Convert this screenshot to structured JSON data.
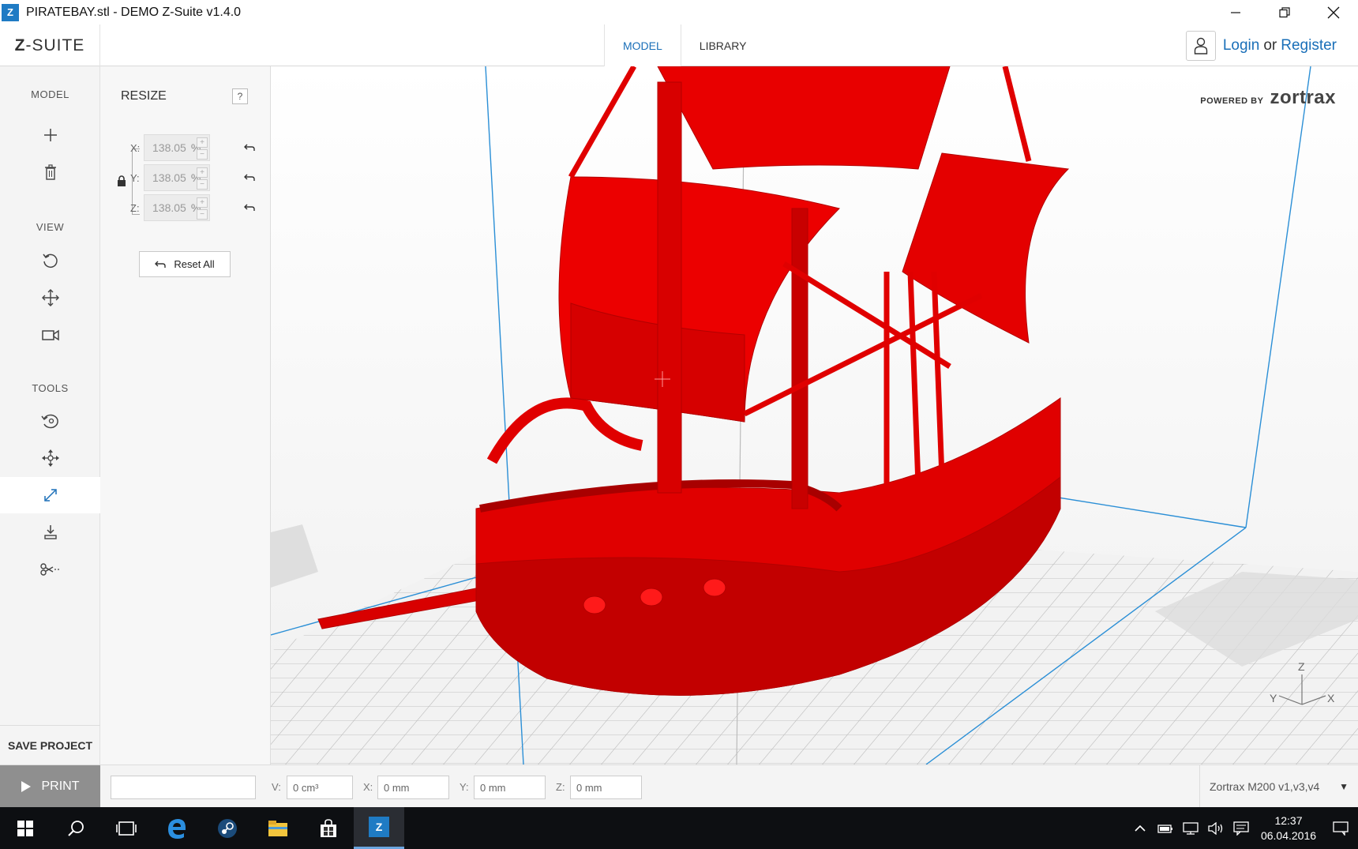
{
  "window": {
    "app_icon_letter": "Z",
    "title": "PIRATEBAY.stl - DEMO Z-Suite v1.4.0"
  },
  "header": {
    "logo_prefix": "Z",
    "logo_rest": "-SUITE",
    "tabs": [
      {
        "label": "MODEL",
        "active": true
      },
      {
        "label": "LIBRARY",
        "active": false
      }
    ],
    "login_label": "Login",
    "or_label": "or",
    "register_label": "Register"
  },
  "sidebar": {
    "model_label": "MODEL",
    "view_label": "VIEW",
    "tools_label": "TOOLS",
    "save_project_label": "SAVE PROJECT",
    "icons": [
      "add-icon",
      "trash-icon",
      "rotate-view-icon",
      "pan-icon",
      "camera-icon",
      "rotate-tool-icon",
      "move-tool-icon",
      "resize-tool-icon",
      "place-on-bed-icon",
      "cut-icon"
    ],
    "active_tool": "resize-tool-icon"
  },
  "resize_panel": {
    "title": "RESIZE",
    "help_label": "?",
    "axes": [
      {
        "label": "X:",
        "value": "138.05",
        "unit": "%"
      },
      {
        "label": "Y:",
        "value": "138.05",
        "unit": "%"
      },
      {
        "label": "Z:",
        "value": "138.05",
        "unit": "%"
      }
    ],
    "stepper_plus": "+",
    "stepper_minus": "−",
    "reset_all_label": "Reset All"
  },
  "viewport": {
    "powered_by": "POWERED BY",
    "brand": "zortrax",
    "model_color": "#ee0000",
    "axis_labels": {
      "z": "Z",
      "y": "Y",
      "x": "X"
    }
  },
  "statusbar": {
    "print_label": "PRINT",
    "progress_text": "",
    "volume_label": "V:",
    "volume_value": "0 cm³",
    "x_label": "X:",
    "x_value": "0 mm",
    "y_label": "Y:",
    "y_value": "0 mm",
    "z_label": "Z:",
    "z_value": "0 mm",
    "printer": "Zortrax M200 v1,v3,v4",
    "printer_caret": "▼"
  },
  "taskbar": {
    "items": [
      "windows-start-icon",
      "search-icon",
      "task-view-icon",
      "edge-icon",
      "steam-icon",
      "file-explorer-icon",
      "store-icon",
      "z-suite-icon"
    ],
    "z_suite_letter": "Z",
    "time": "12:37",
    "date": "06.04.2016"
  },
  "colors": {
    "accent": "#1a6fb8",
    "print_button": "#8f8f8f",
    "taskbar": "#0d0f12",
    "build_volume_lines": "#2b8fd6"
  }
}
